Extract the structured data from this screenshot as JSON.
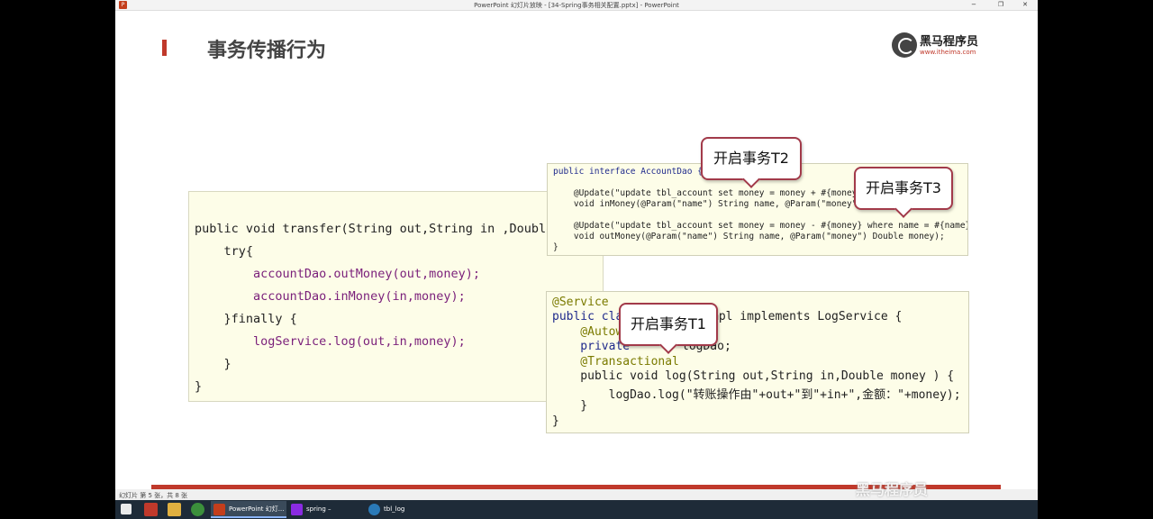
{
  "window": {
    "title": "PowerPoint 幻灯片放映 - [34-Spring事务相关配置.pptx] - PowerPoint",
    "controls": [
      "−",
      "❐",
      "✕"
    ]
  },
  "slide": {
    "title": "事务传播行为",
    "logo_name": "黑马程序员",
    "logo_url": "www.itheima.com",
    "transfer_code": [
      "public void transfer(String out,String in ,Double mo",
      "    try{",
      "        accountDao.outMoney(out,money);",
      "        accountDao.inMoney(in,money);",
      "    }finally {",
      "        logService.log(out,in,money);",
      "    }",
      "}"
    ],
    "dao_code": [
      "public interface AccountDao {",
      "",
      "    @Update(\"update tbl_account set money = money + #{money} w",
      "    void inMoney(@Param(\"name\") String name, @Param(\"money\") D",
      "",
      "    @Update(\"update tbl_account set money = money - #{money} where name = #{name}\")",
      "    void outMoney(@Param(\"name\") String name, @Param(\"money\") Double money);",
      "}"
    ],
    "log_code": [
      "@Service",
      "public cla",
      "    @Autow",
      "    private",
      "    @Transactional",
      "    public void log(String out,String in,Double money ) {",
      "        logDao.log(\"转账操作由\"+out+\"到\"+in+\",金额：\"+money);",
      "    }",
      "}"
    ],
    "log_code_right": [
      "mpl implements LogService {",
      "logDao;"
    ],
    "callouts": {
      "t1": "开启事务T1",
      "t2": "开启事务T2",
      "t3": "开启事务T3"
    },
    "accent_color": "#c0392b"
  },
  "statusbar": {
    "text": "幻灯片 第 5 张，共 8 张"
  },
  "watermark": "黑马程序员",
  "taskbar": {
    "items": [
      {
        "label": "PowerPoint 幻灯...",
        "icon": "powerpoint-icon"
      },
      {
        "label": "spring – Account...",
        "icon": "intellij-icon"
      },
      {
        "label": "tbl_log @spring_...",
        "icon": "datagrip-icon"
      }
    ]
  }
}
